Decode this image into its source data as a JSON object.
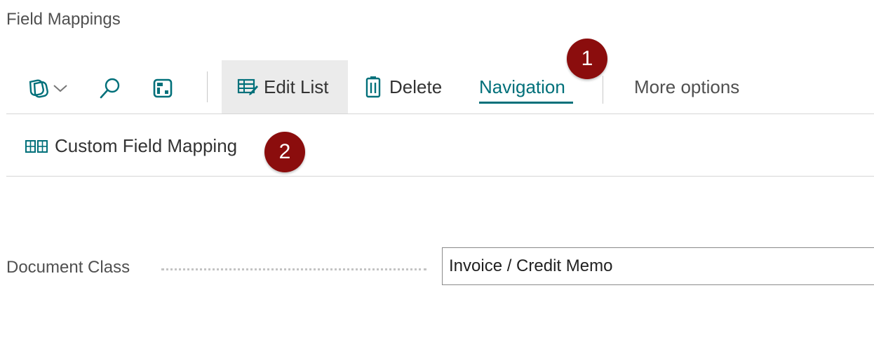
{
  "page": {
    "title": "Field Mappings"
  },
  "toolbar": {
    "edit_list_label": "Edit List",
    "delete_label": "Delete",
    "navigation_label": "Navigation",
    "more_options_label": "More options",
    "badge_1": "1"
  },
  "subbar": {
    "custom_field_mapping_label": "Custom Field Mapping",
    "badge_2": "2"
  },
  "fields": {
    "document_class_label": "Document Class",
    "document_class_value": "Invoice / Credit Memo"
  },
  "icons": [
    "document-copy-icon",
    "chevron-down-icon",
    "search-icon",
    "table-icon",
    "edit-table-icon",
    "trash-icon",
    "field-mapping-icon"
  ],
  "colors": {
    "accent": "#00707a",
    "badge": "#8b0d0d"
  }
}
